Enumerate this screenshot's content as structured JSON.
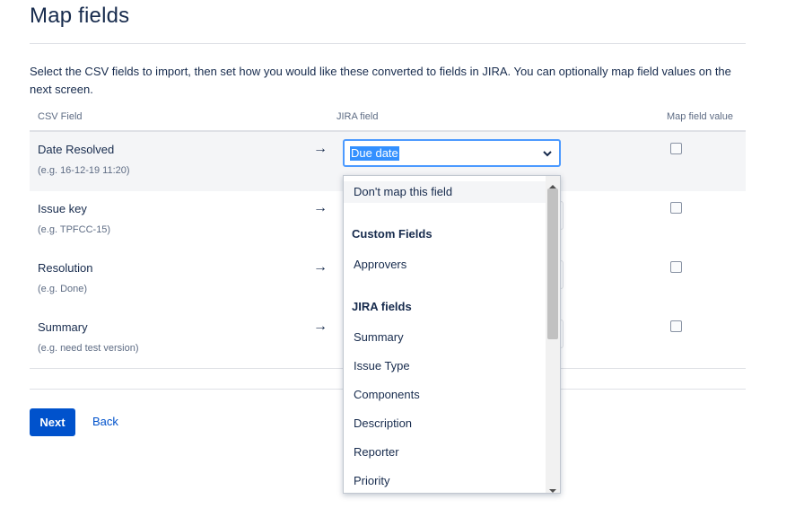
{
  "page": {
    "title": "Map fields",
    "intro": "Select the CSV fields to import, then set how you would like these converted to fields in JIRA. You can optionally map field values on the next screen."
  },
  "table": {
    "headers": {
      "csv": "CSV Field",
      "jira": "JIRA field",
      "map": "Map field value"
    },
    "arrow": "→",
    "rows": [
      {
        "name": "Date Resolved",
        "example": "(e.g. 16-12-19 11:20)",
        "map_checked": false
      },
      {
        "name": "Issue key",
        "example": "(e.g. TPFCC-15)",
        "map_checked": false
      },
      {
        "name": "Resolution",
        "example": "(e.g. Done)",
        "map_checked": false
      },
      {
        "name": "Summary",
        "example": "(e.g. need test version)",
        "map_checked": false
      }
    ]
  },
  "select": {
    "value": "Due date",
    "chevron_icon": "chevron-down-icon"
  },
  "dropdown": {
    "dont_map": "Don't map this field",
    "group_custom": "Custom Fields",
    "custom_items": [
      "Approvers"
    ],
    "group_jira": "JIRA fields",
    "jira_items": [
      "Summary",
      "Issue Type",
      "Components",
      "Description",
      "Reporter",
      "Priority"
    ]
  },
  "actions": {
    "next_label": "Next",
    "back_label": "Back"
  },
  "colors": {
    "primary": "#0052cc",
    "focus": "#4c9aff",
    "selection": "#3390ff"
  }
}
